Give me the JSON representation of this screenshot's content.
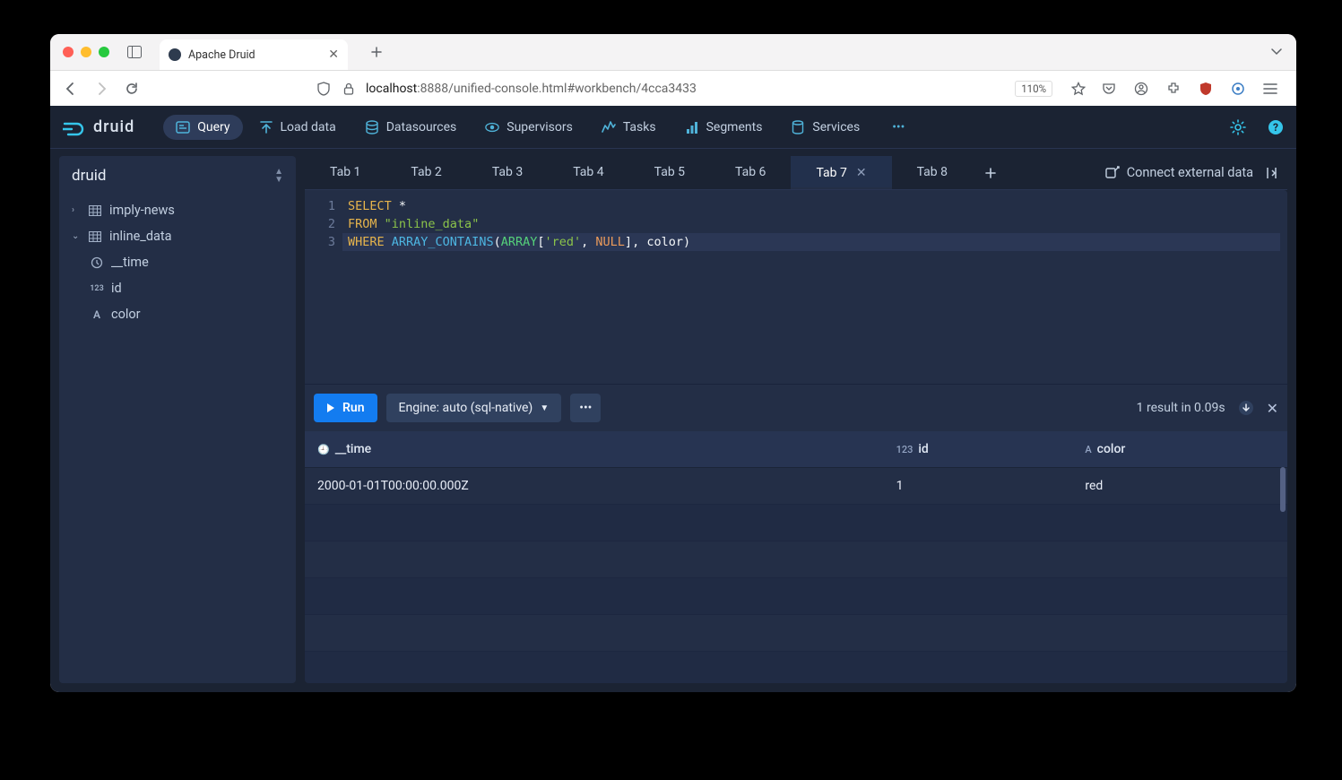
{
  "browser": {
    "tab_title": "Apache Druid",
    "url_host": "localhost",
    "url_port": ":8888",
    "url_path": "/unified-console.html#workbench/4cca3433",
    "zoom": "110%"
  },
  "app": {
    "brand": "druid",
    "nav": [
      {
        "label": "Query",
        "active": true
      },
      {
        "label": "Load data"
      },
      {
        "label": "Datasources"
      },
      {
        "label": "Supervisors"
      },
      {
        "label": "Tasks"
      },
      {
        "label": "Segments"
      },
      {
        "label": "Services"
      }
    ]
  },
  "sidebar": {
    "title": "druid",
    "datasources": [
      {
        "name": "imply-news",
        "expanded": false
      },
      {
        "name": "inline_data",
        "expanded": true,
        "columns": [
          {
            "name": "__time",
            "type": "time"
          },
          {
            "name": "id",
            "type": "number"
          },
          {
            "name": "color",
            "type": "string"
          }
        ]
      }
    ]
  },
  "workbench": {
    "tabs": [
      "Tab 1",
      "Tab 2",
      "Tab 3",
      "Tab 4",
      "Tab 5",
      "Tab 6",
      "Tab 7",
      "Tab 8"
    ],
    "active_tab_index": 6,
    "connect_external": "Connect external data"
  },
  "query": {
    "lines": [
      {
        "n": 1,
        "tokens": [
          [
            "kw",
            "SELECT"
          ],
          [
            "sp",
            " "
          ],
          [
            "star",
            "*"
          ]
        ]
      },
      {
        "n": 2,
        "tokens": [
          [
            "kw",
            "FROM"
          ],
          [
            "sp",
            " "
          ],
          [
            "str",
            "\"inline_data\""
          ]
        ]
      },
      {
        "n": 3,
        "hl": true,
        "tokens": [
          [
            "kw",
            "WHERE"
          ],
          [
            "sp",
            " "
          ],
          [
            "func",
            "ARRAY_CONTAINS"
          ],
          [
            "brk",
            "("
          ],
          [
            "arr",
            "ARRAY"
          ],
          [
            "brk",
            "["
          ],
          [
            "str",
            "'red'"
          ],
          [
            "ident",
            ", "
          ],
          [
            "null",
            "NULL"
          ],
          [
            "brk",
            "]"
          ],
          [
            "ident",
            ", color"
          ],
          [
            "brk",
            ")"
          ]
        ]
      }
    ]
  },
  "run": {
    "run_label": "Run",
    "engine_label": "Engine: auto (sql-native)",
    "result_text": "1 result in 0.09s"
  },
  "results": {
    "columns": [
      {
        "name": "__time",
        "type": "time"
      },
      {
        "name": "id",
        "type": "number"
      },
      {
        "name": "color",
        "type": "string"
      }
    ],
    "rows": [
      {
        "__time": "2000-01-01T00:00:00.000Z",
        "id": "1",
        "color": "red"
      }
    ]
  }
}
